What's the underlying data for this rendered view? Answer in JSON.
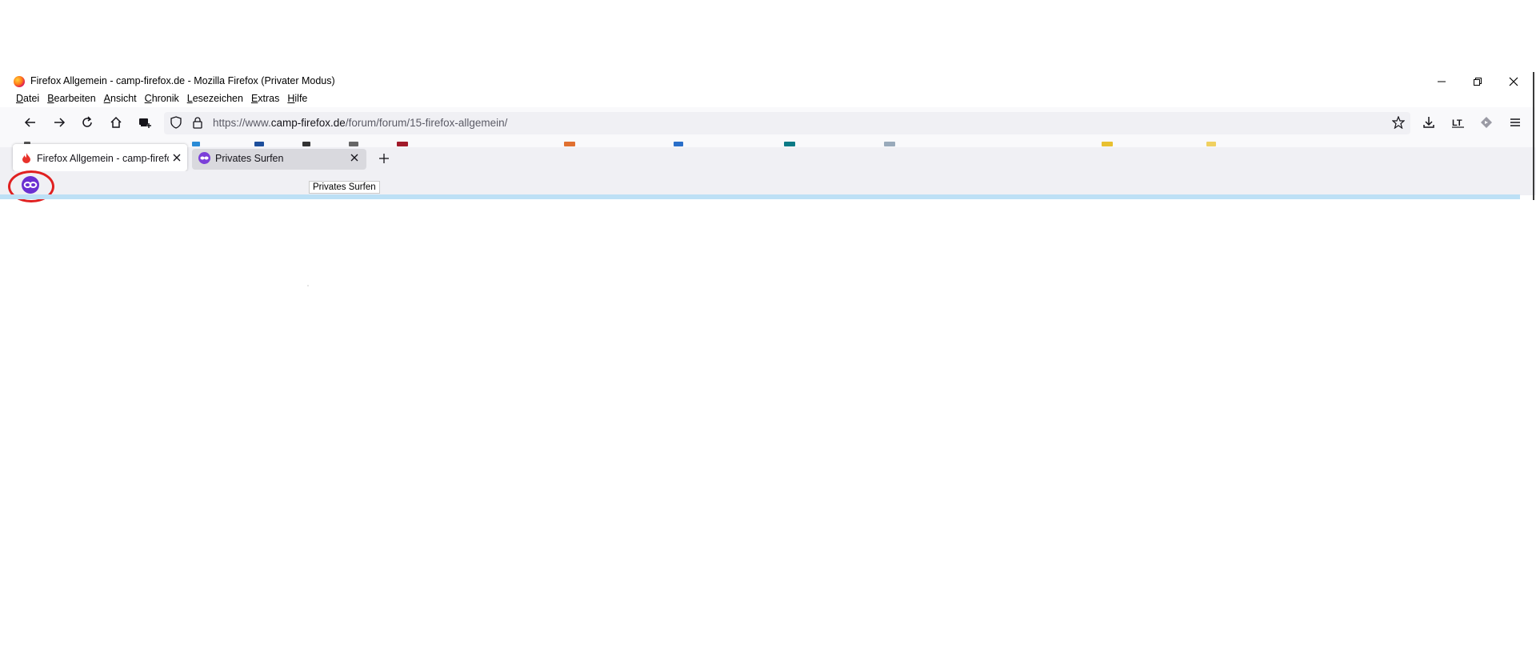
{
  "window": {
    "title": "Firefox Allgemein - camp-firefox.de - Mozilla Firefox (Privater Modus)",
    "controls": [
      "minimize",
      "restore",
      "close"
    ]
  },
  "menu": {
    "items": [
      {
        "access": "D",
        "rest": "atei"
      },
      {
        "access": "B",
        "rest": "earbeiten"
      },
      {
        "access": "A",
        "rest": "nsicht"
      },
      {
        "access": "C",
        "rest": "hronik"
      },
      {
        "access": "L",
        "rest": "esezeichen"
      },
      {
        "access": "E",
        "rest": "xtras"
      },
      {
        "access": "H",
        "rest": "ilfe"
      }
    ]
  },
  "navigation": {
    "url_prefix": "https://www.",
    "url_host": "camp-firefox.de",
    "url_path": "/forum/forum/15-firefox-allgemein/"
  },
  "tabs": [
    {
      "label": "Firefox Allgemein - camp-firefox.de",
      "active": true,
      "icon": "flame-icon"
    },
    {
      "label": "Privates Surfen",
      "active": false,
      "icon": "private-mask-icon"
    }
  ],
  "tooltip": {
    "text": "Privates Surfen"
  },
  "colors": {
    "private_purple": "#6b2fd1",
    "highlight_red": "#e02020",
    "toolbar_bg": "#f9f9fb",
    "urlbar_bg": "#f0f0f4"
  }
}
